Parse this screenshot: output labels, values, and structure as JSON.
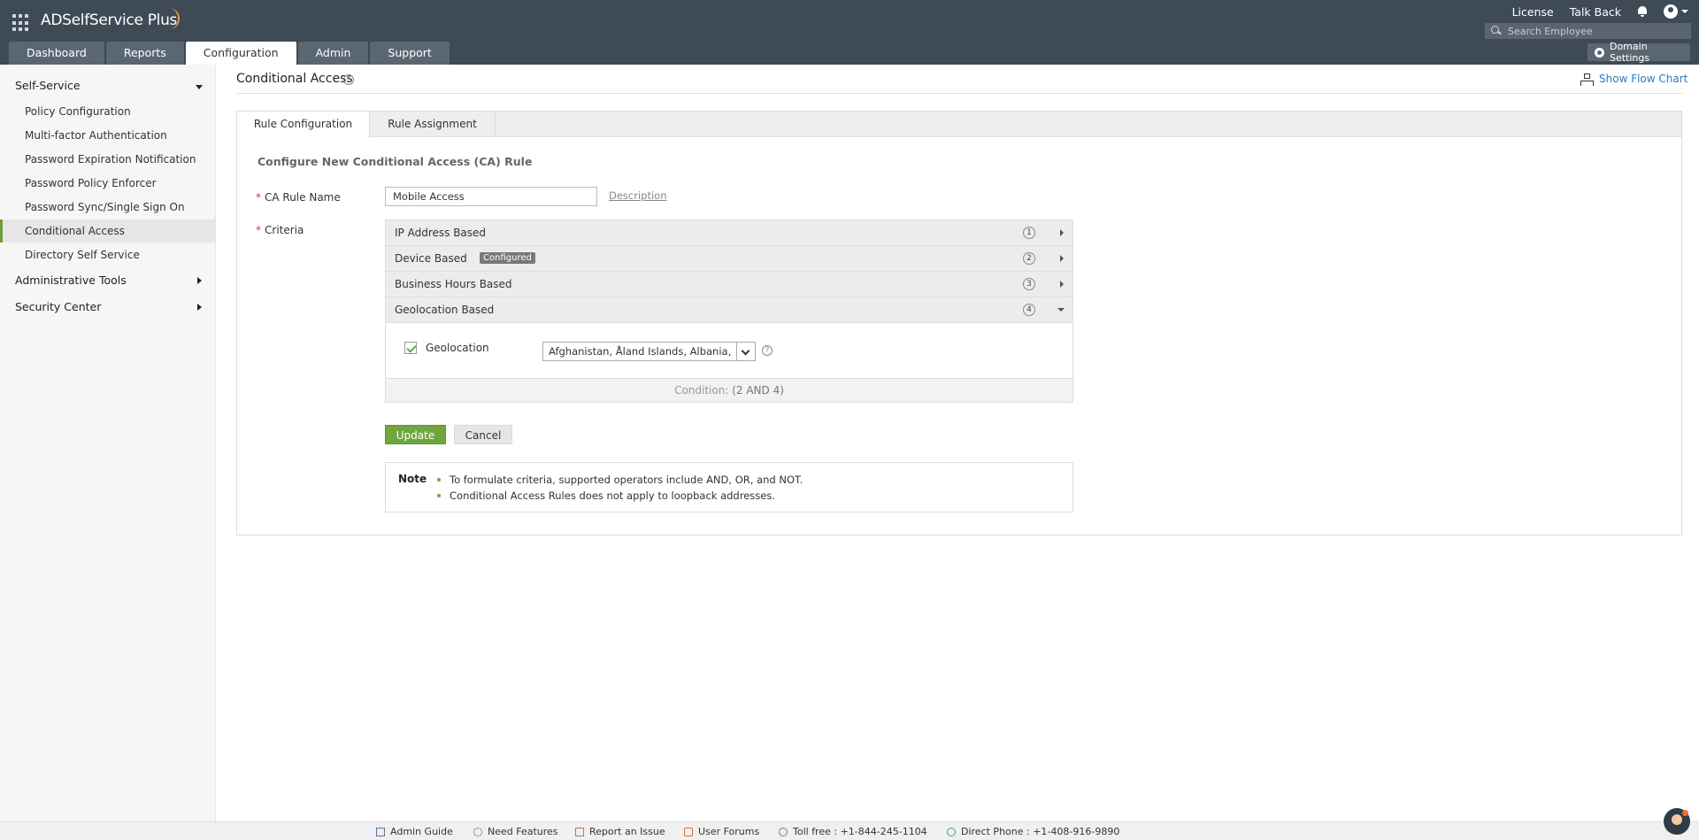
{
  "header": {
    "app_name": "ADSelfService Plus",
    "links": {
      "license": "License",
      "talk_back": "Talk Back"
    },
    "search_placeholder": "Search Employee",
    "nav_tabs": [
      "Dashboard",
      "Reports",
      "Configuration",
      "Admin",
      "Support"
    ],
    "active_tab": "Configuration",
    "domain_settings": "Domain Settings"
  },
  "sidebar": {
    "self_service": "Self-Service",
    "items": [
      "Policy Configuration",
      "Multi-factor Authentication",
      "Password Expiration Notification",
      "Password Policy Enforcer",
      "Password Sync/Single Sign On",
      "Conditional Access",
      "Directory Self Service"
    ],
    "active_item": "Conditional Access",
    "administrative_tools": "Administrative Tools",
    "security_center": "Security Center"
  },
  "main": {
    "title": "Conditional Access",
    "show_flow_chart": "Show Flow Chart",
    "tabs": [
      "Rule Configuration",
      "Rule Assignment"
    ],
    "form_heading": "Configure New Conditional Access (CA) Rule",
    "rule_name_label": "CA Rule Name",
    "rule_name_value": "Mobile Access",
    "description_link": "Description",
    "criteria_label": "Criteria",
    "criteria": [
      {
        "label": "IP Address Based",
        "num": "1"
      },
      {
        "label": "Device Based",
        "num": "2",
        "badge": "Configured"
      },
      {
        "label": "Business Hours Based",
        "num": "3"
      },
      {
        "label": "Geolocation Based",
        "num": "4"
      }
    ],
    "geolocation_label": "Geolocation",
    "geolocation_value": "Afghanistan, Åland Islands, Albania,",
    "condition_prefix": "Condition:",
    "condition_value": "(2 AND 4)",
    "update_button": "Update",
    "cancel_button": "Cancel",
    "note_title": "Note",
    "notes": [
      "To formulate criteria, supported operators include AND, OR, and NOT.",
      "Conditional Access Rules does not apply to loopback addresses."
    ]
  },
  "footer": {
    "admin_guide": "Admin Guide",
    "need_features": "Need Features",
    "report_issue": "Report an Issue",
    "user_forums": "User Forums",
    "toll_free": "Toll free : +1-844-245-1104",
    "direct_phone": "Direct Phone : +1-408-916-9890"
  },
  "colors": {
    "header_bg": "#3e4a56",
    "accent_green": "#6fa63e",
    "link_blue": "#2e7bbf"
  }
}
